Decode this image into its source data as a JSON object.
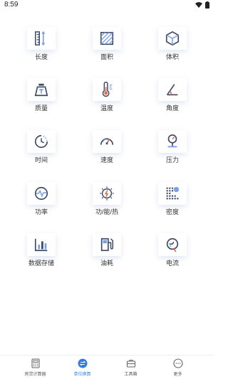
{
  "status": {
    "time": "8:59",
    "wifi_icon": "wifi-icon",
    "battery_icon": "battery-icon"
  },
  "units": [
    {
      "label": "长度",
      "icon": "ruler-icon"
    },
    {
      "label": "面积",
      "icon": "area-square-icon"
    },
    {
      "label": "体积",
      "icon": "cube-icon"
    },
    {
      "label": "质量",
      "icon": "weight-icon"
    },
    {
      "label": "温度",
      "icon": "thermometer-icon"
    },
    {
      "label": "角度",
      "icon": "angle-icon"
    },
    {
      "label": "时间",
      "icon": "clock-icon"
    },
    {
      "label": "速度",
      "icon": "speedometer-icon"
    },
    {
      "label": "压力",
      "icon": "pressure-gauge-icon"
    },
    {
      "label": "功率",
      "icon": "power-icon"
    },
    {
      "label": "功/能/热",
      "icon": "energy-icon"
    },
    {
      "label": "密度",
      "icon": "density-icon"
    },
    {
      "label": "数据存储",
      "icon": "data-storage-icon"
    },
    {
      "label": "油耗",
      "icon": "fuel-icon"
    },
    {
      "label": "电流",
      "icon": "current-icon"
    }
  ],
  "tabs": [
    {
      "label": "房贷计算器",
      "icon": "calculator-icon",
      "active": false
    },
    {
      "label": "单位换算",
      "icon": "convert-icon",
      "active": true
    },
    {
      "label": "工具箱",
      "icon": "toolbox-icon",
      "active": false
    },
    {
      "label": "更多",
      "icon": "more-icon",
      "active": false
    }
  ],
  "colors": {
    "accent": "#2f7de1",
    "icon_dark": "#3c4a66",
    "icon_light": "#7aa0e6"
  }
}
